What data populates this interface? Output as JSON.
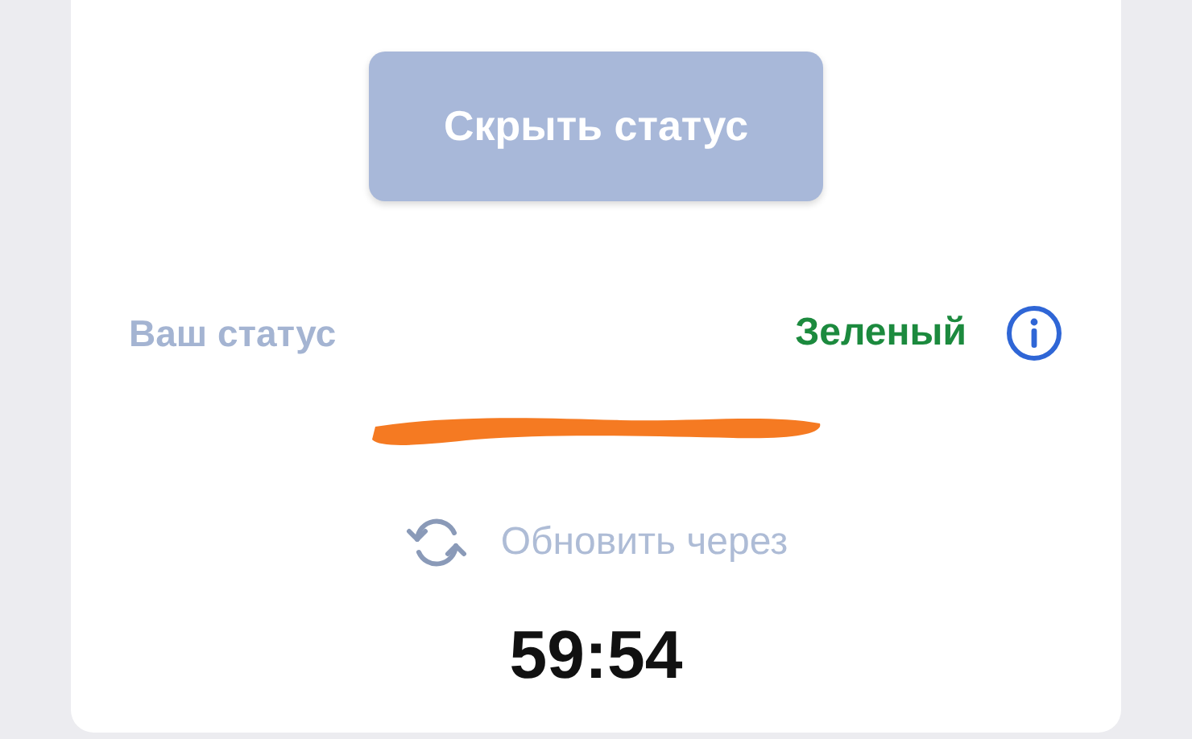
{
  "hide_button": {
    "label": "Скрыть статус",
    "disabled": true
  },
  "status": {
    "label": "Ваш статус",
    "value": "Зеленый"
  },
  "refresh": {
    "label": "Обновить через",
    "timer": "59:54"
  }
}
